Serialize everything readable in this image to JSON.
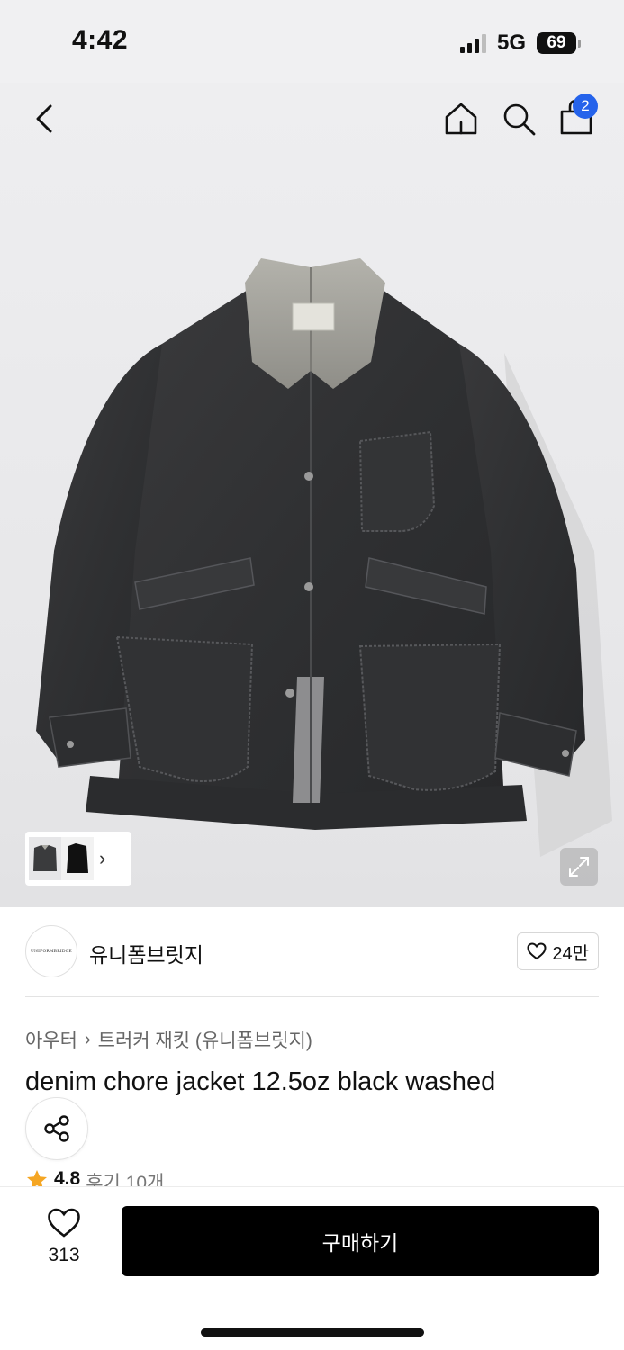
{
  "status_bar": {
    "time": "4:42",
    "network": "5G",
    "battery": "69"
  },
  "nav": {
    "back_icon": "chevron-left-icon",
    "home_icon": "home-icon",
    "search_icon": "search-icon",
    "cart_icon": "shopping-bag-icon",
    "cart_count": "2"
  },
  "hero": {
    "image": "denim chore jacket product photo",
    "thumb_more": "›"
  },
  "brand": {
    "logo_text": "UNIFORMBRIDGE",
    "name": "유니폼브릿지",
    "likes": "24만"
  },
  "breadcrumb": {
    "items": [
      "아우터",
      "트러커 재킷 (유니폼브릿지)"
    ],
    "separator": "›"
  },
  "product": {
    "title": "denim chore jacket 12.5oz black washed",
    "rating": "4.8",
    "reviews": "후기 10개"
  },
  "bottom_bar": {
    "wish_count": "313",
    "buy_label": "구매하기"
  },
  "colors": {
    "accent": "#2563eb",
    "buy_button": "#000000",
    "star": "#f5a623"
  }
}
